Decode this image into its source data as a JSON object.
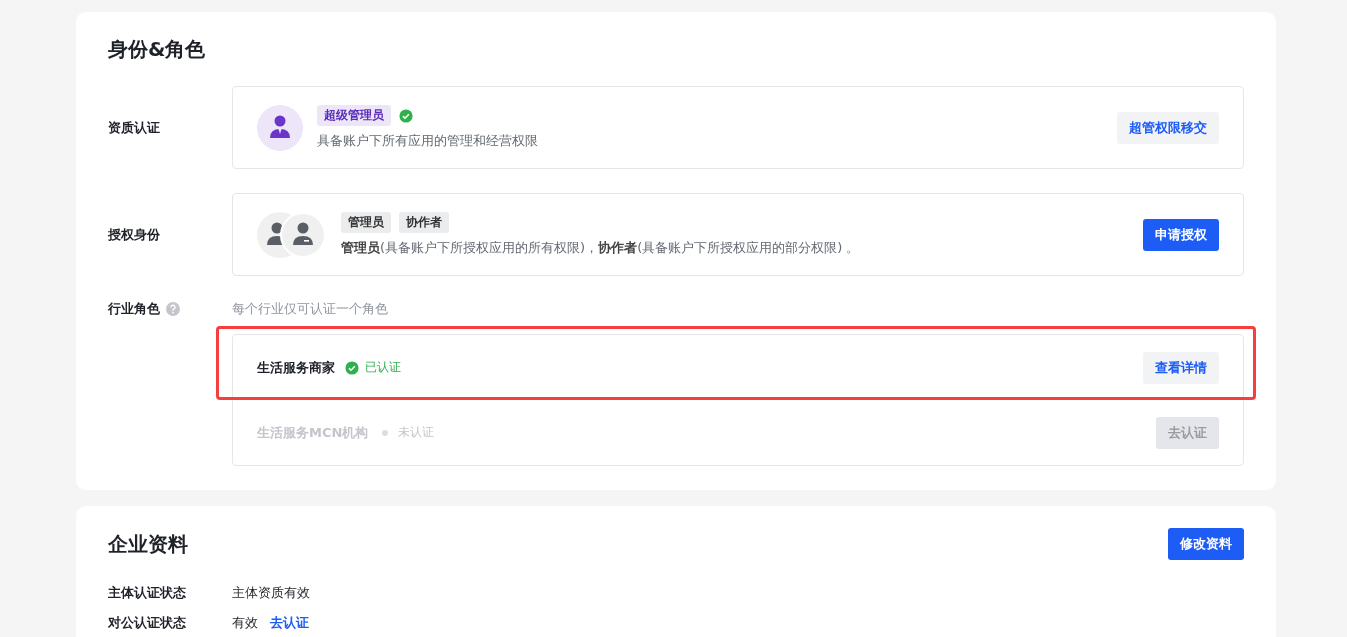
{
  "identity": {
    "title": "身份&角色",
    "qualification": {
      "label": "资质认证",
      "tag": "超级管理员",
      "verified": true,
      "description": "具备账户下所有应用的管理和经营权限",
      "button": "超管权限移交"
    },
    "authorization": {
      "label": "授权身份",
      "tags": [
        "管理员",
        "协作者"
      ],
      "description": "**管理员**(具备账户下所授权应用的所有权限)，**协作者**(具备账户下所授权应用的部分权限) 。",
      "button": "申请授权"
    },
    "industry": {
      "label": "行业角色",
      "hint": "每个行业仅可认证一个角色",
      "roles": [
        {
          "name": "生活服务商家",
          "status": "已认证",
          "certified": true,
          "highlighted": true,
          "button": "查看详情"
        },
        {
          "name": "生活服务MCN机构",
          "status": "未认证",
          "certified": false,
          "highlighted": false,
          "button": "去认证"
        }
      ]
    }
  },
  "company": {
    "title": "企业资料",
    "button": "修改资料",
    "fields": [
      {
        "label": "主体认证状态",
        "value": "主体资质有效"
      },
      {
        "label": "对公认证状态",
        "value": "有效",
        "link": "去认证"
      }
    ]
  }
}
